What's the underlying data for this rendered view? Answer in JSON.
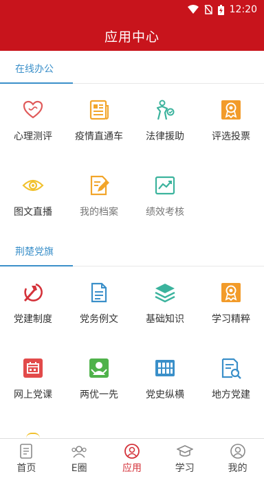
{
  "status": {
    "time": "12:20"
  },
  "header": {
    "title": "应用中心"
  },
  "sections": [
    {
      "title": "在线办公",
      "items": [
        {
          "label": "心理测评",
          "icon": "heart-icon"
        },
        {
          "label": "疫情直通车",
          "icon": "newspaper-icon"
        },
        {
          "label": "法律援助",
          "icon": "balance-icon"
        },
        {
          "label": "评选投票",
          "icon": "award-icon"
        },
        {
          "label": "图文直播",
          "icon": "eye-icon"
        },
        {
          "label": "我的档案",
          "icon": "edit-document-icon"
        },
        {
          "label": "绩效考核",
          "icon": "chart-icon"
        }
      ]
    },
    {
      "title": "荆楚党旗",
      "items": [
        {
          "label": "党建制度",
          "icon": "party-emblem-icon"
        },
        {
          "label": "党务例文",
          "icon": "document-icon"
        },
        {
          "label": "基础知识",
          "icon": "layers-icon"
        },
        {
          "label": "学习精粹",
          "icon": "award-icon"
        },
        {
          "label": "网上党课",
          "icon": "calendar-icon"
        },
        {
          "label": "两优一先",
          "icon": "people-icon"
        },
        {
          "label": "党史纵横",
          "icon": "books-icon"
        },
        {
          "label": "地方党建",
          "icon": "search-document-icon"
        }
      ]
    }
  ],
  "nav": [
    {
      "label": "首页",
      "icon": "home-doc-icon"
    },
    {
      "label": "E圈",
      "icon": "group-icon"
    },
    {
      "label": "应用",
      "icon": "apps-icon",
      "active": true
    },
    {
      "label": "学习",
      "icon": "grad-cap-icon"
    },
    {
      "label": "我的",
      "icon": "person-icon"
    }
  ]
}
